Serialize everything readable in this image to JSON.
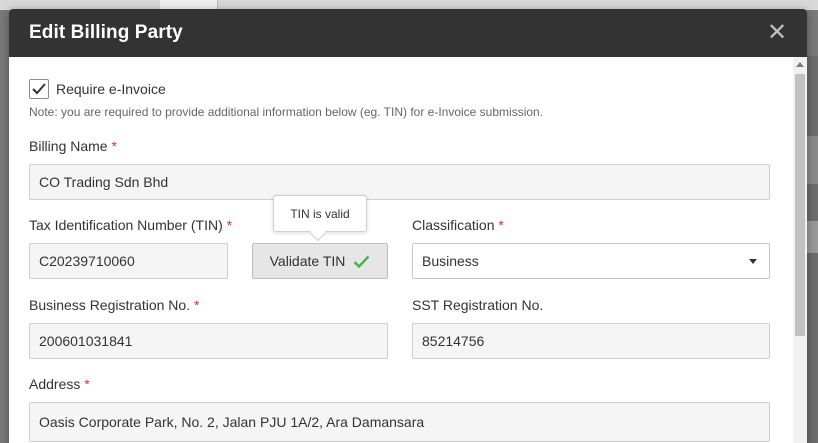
{
  "modal": {
    "title": "Edit Billing Party",
    "close_icon": "close-icon"
  },
  "einvoice": {
    "checkbox_label": "Require e-Invoice",
    "checked": true,
    "note": "Note: you are required to provide additional information below (eg. TIN) for e-Invoice submission."
  },
  "fields": {
    "billing_name": {
      "label": "Billing Name",
      "required": "*",
      "value": "CO Trading Sdn Bhd"
    },
    "tin": {
      "label": "Tax Identification Number (TIN)",
      "required": "*",
      "value": "C20239710060"
    },
    "validate_button": {
      "label": "Validate TIN",
      "icon": "check-icon"
    },
    "tooltip": {
      "text": "TIN is valid"
    },
    "classification": {
      "label": "Classification",
      "required": "*",
      "value": "Business"
    },
    "brn": {
      "label": "Business Registration No.",
      "required": "*",
      "value": "200601031841"
    },
    "sst": {
      "label": "SST Registration No.",
      "value": "85214756"
    },
    "address": {
      "label": "Address",
      "required": "*",
      "value": "Oasis Corporate Park, No. 2, Jalan PJU 1A/2, Ara Damansara"
    }
  },
  "colors": {
    "header_bg": "#333333",
    "required": "#d9342b",
    "valid_check": "#4caf50"
  }
}
